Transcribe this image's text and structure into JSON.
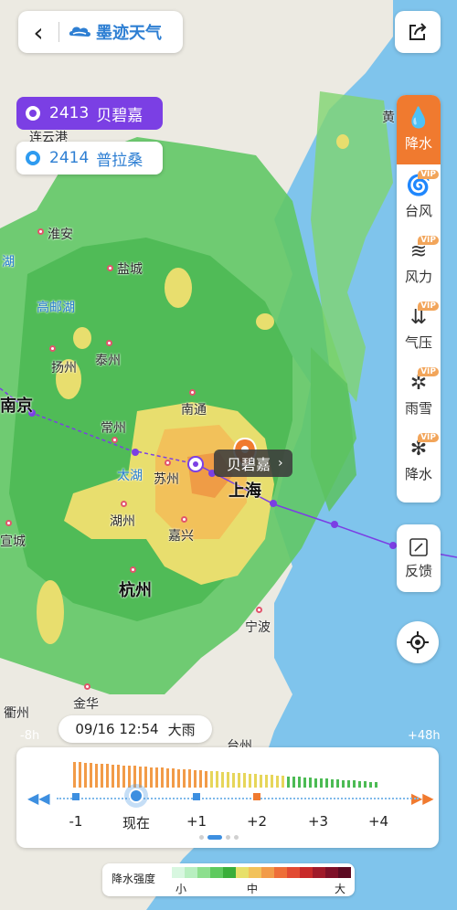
{
  "app": {
    "brand_name": "墨迹天气",
    "back_icon": "chevron-left-icon",
    "share_icon": "share-icon"
  },
  "typhoons": [
    {
      "code": "2413",
      "name": "贝碧嘉",
      "color": "#7b3fe4"
    },
    {
      "code": "2414",
      "name": "普拉桑",
      "color": "#2e9bf0"
    }
  ],
  "map": {
    "cities": [
      "连云港",
      "淮安",
      "盐城",
      "高邮湖",
      "扬州",
      "泰州",
      "南京",
      "常州",
      "南通",
      "太湖",
      "苏州",
      "上海",
      "湖州",
      "嘉兴",
      "杭州",
      "宣城",
      "宁波",
      "金华",
      "衢州",
      "台州",
      "黄",
      "湖"
    ],
    "typhoon_marker_label": "贝碧嘉"
  },
  "side_menu": {
    "items": [
      {
        "label": "降水",
        "icon": "rain-icon",
        "vip": false,
        "active": true
      },
      {
        "label": "台风",
        "icon": "typhoon-icon",
        "vip": true,
        "active": false
      },
      {
        "label": "风力",
        "icon": "wind-icon",
        "vip": true,
        "active": false
      },
      {
        "label": "气压",
        "icon": "pressure-icon",
        "vip": true,
        "active": false
      },
      {
        "label": "雨雪",
        "icon": "rain-snow-icon",
        "vip": true,
        "active": false
      },
      {
        "label": "降水",
        "icon": "precip-snow-icon",
        "vip": true,
        "active": false
      }
    ],
    "vip_label": "VIP",
    "feedback_label": "反馈",
    "locate_icon": "locate-icon"
  },
  "timeline": {
    "current_time": "09/16 12:54",
    "current_weather": "大雨",
    "left_edge": "-8h",
    "right_edge": "+48h",
    "ticks": [
      "-1",
      "现在",
      "+1",
      "+2",
      "+3",
      "+4"
    ]
  },
  "legend": {
    "title": "降水强度",
    "low": "小",
    "mid": "中",
    "high": "大"
  },
  "colors": {
    "accent": "#f07a2f",
    "typhoon_primary": "#7b3fe4",
    "typhoon_secondary": "#2e9bf0",
    "brand": "#2e7fd3"
  }
}
